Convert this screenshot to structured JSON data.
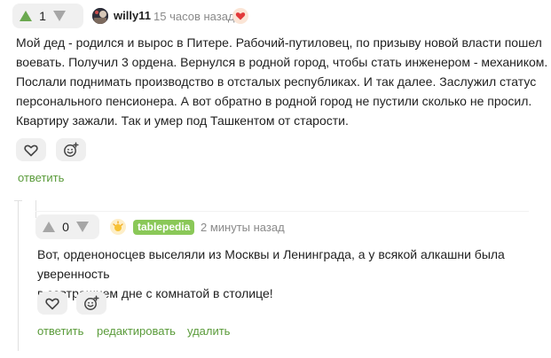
{
  "comment1": {
    "votes": "1",
    "author": "willy11",
    "time": "15 часов назад",
    "text_lines": [
      "Мой дед - родился и вырос в Питере. Рабочий-путиловец, по призыву новой власти пошел",
      "воевать. Получил 3 ордена. Вернулся в родной город, чтобы стать инженером - механиком.",
      "Послали поднимать производство в отсталых республиках. И так далее. Заслужил статус",
      "персонального пенсионера. А вот обратно в родной город не пустили сколько не просил.",
      "Квартиру зажали. Так и умер под Ташкентом от старости."
    ],
    "reply_label": "ответить"
  },
  "comment2": {
    "votes": "0",
    "author": "tablepedia",
    "time": "2 минуты назад",
    "text_lines": [
      "Вот, орденоносцев выселяли из Москвы и Ленинграда, а у всякой алкашни была уверенность",
      "в завтрашнем дне с комнатой в столице!"
    ],
    "reply_label": "ответить",
    "edit_label": "редактировать",
    "delete_label": "удалить"
  },
  "colors": {
    "upvote_active": "#6aa84f",
    "link_green": "#5a9b3a",
    "author_tag": "#8ac858"
  },
  "icons": {
    "upvote": "triangle-up-icon",
    "downvote": "triangle-down-icon",
    "like": "heart-icon",
    "react": "emoji-plus-icon",
    "award": "heart-badge-icon",
    "own_badge": "sun-badge-icon"
  }
}
